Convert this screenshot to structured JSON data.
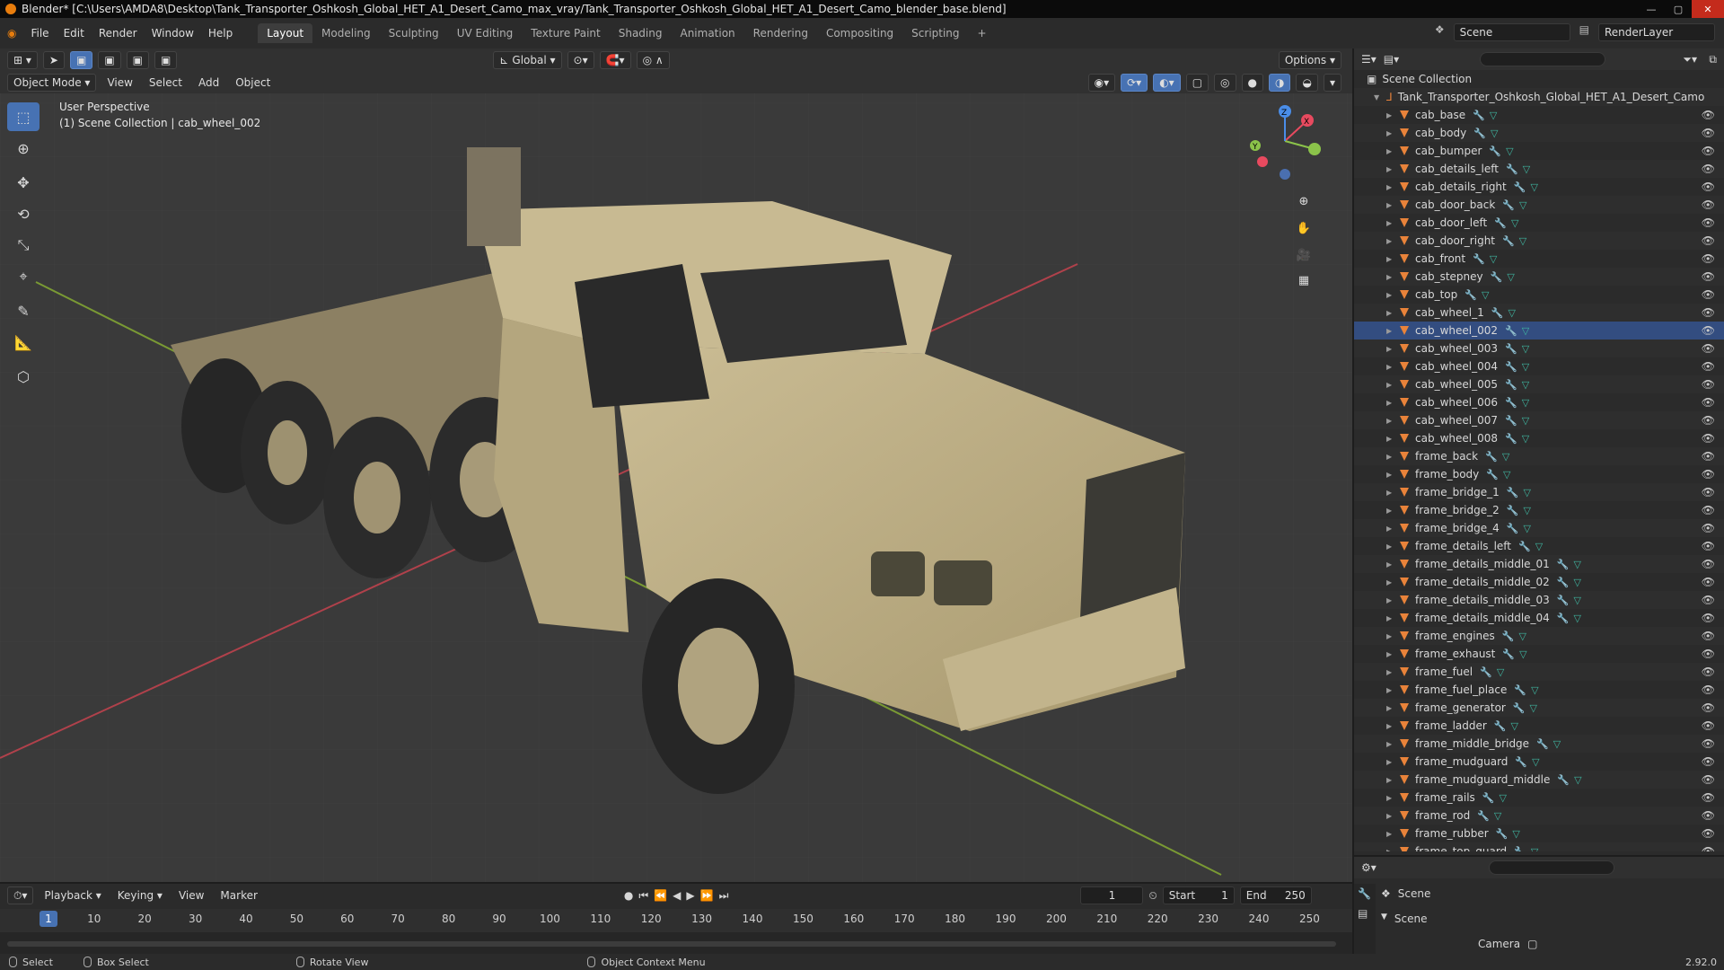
{
  "titlebar": {
    "title": "Blender* [C:\\Users\\AMDA8\\Desktop\\Tank_Transporter_Oshkosh_Global_HET_A1_Desert_Camo_max_vray/Tank_Transporter_Oshkosh_Global_HET_A1_Desert_Camo_blender_base.blend]"
  },
  "menu": [
    "File",
    "Edit",
    "Render",
    "Window",
    "Help"
  ],
  "workspaces": [
    "Layout",
    "Modeling",
    "Sculpting",
    "UV Editing",
    "Texture Paint",
    "Shading",
    "Animation",
    "Rendering",
    "Compositing",
    "Scripting"
  ],
  "scene": {
    "name": "Scene",
    "render_layer": "RenderLayer"
  },
  "viewport": {
    "mode": "Object Mode",
    "menus": [
      "View",
      "Select",
      "Add",
      "Object"
    ],
    "transform_orientation": "Global",
    "options_label": "Options",
    "info_line1": "User Perspective",
    "info_line2": "(1) Scene Collection | cab_wheel_002"
  },
  "outliner": {
    "root": "Scene Collection",
    "collection": "Tank_Transporter_Oshkosh_Global_HET_A1_Desert_Camo",
    "items": [
      "cab_base",
      "cab_body",
      "cab_bumper",
      "cab_details_left",
      "cab_details_right",
      "cab_door_back",
      "cab_door_left",
      "cab_door_right",
      "cab_front",
      "cab_stepney",
      "cab_top",
      "cab_wheel_1",
      "cab_wheel_002",
      "cab_wheel_003",
      "cab_wheel_004",
      "cab_wheel_005",
      "cab_wheel_006",
      "cab_wheel_007",
      "cab_wheel_008",
      "frame_back",
      "frame_body",
      "frame_bridge_1",
      "frame_bridge_2",
      "frame_bridge_4",
      "frame_details_left",
      "frame_details_middle_01",
      "frame_details_middle_02",
      "frame_details_middle_03",
      "frame_details_middle_04",
      "frame_engines",
      "frame_exhaust",
      "frame_fuel",
      "frame_fuel_place",
      "frame_generator",
      "frame_ladder",
      "frame_middle_bridge",
      "frame_mudguard",
      "frame_mudguard_middle",
      "frame_rails",
      "frame_rod",
      "frame_rubber",
      "frame_top_guard"
    ],
    "selected": "cab_wheel_002"
  },
  "properties": {
    "context": "Scene",
    "section": "Scene",
    "camera_label": "Camera"
  },
  "timeline": {
    "menus": [
      "Playback",
      "Keying",
      "View",
      "Marker"
    ],
    "current_frame": "1",
    "start_label": "Start",
    "start": "1",
    "end_label": "End",
    "end": "250",
    "ticks": [
      "10",
      "20",
      "30",
      "40",
      "50",
      "60",
      "70",
      "80",
      "90",
      "100",
      "110",
      "120",
      "130",
      "140",
      "150",
      "160",
      "170",
      "180",
      "190",
      "200",
      "210",
      "220",
      "230",
      "240",
      "250"
    ]
  },
  "statusbar": {
    "select": "Select",
    "box_select": "Box Select",
    "rotate_view": "Rotate View",
    "context_menu": "Object Context Menu",
    "version": "2.92.0"
  },
  "colors": {
    "accent": "#4772b3",
    "object_icon": "#e9833a",
    "grid_x": "#b0414b",
    "grid_y": "#7a9a34",
    "tank_body": "#bcae86"
  }
}
